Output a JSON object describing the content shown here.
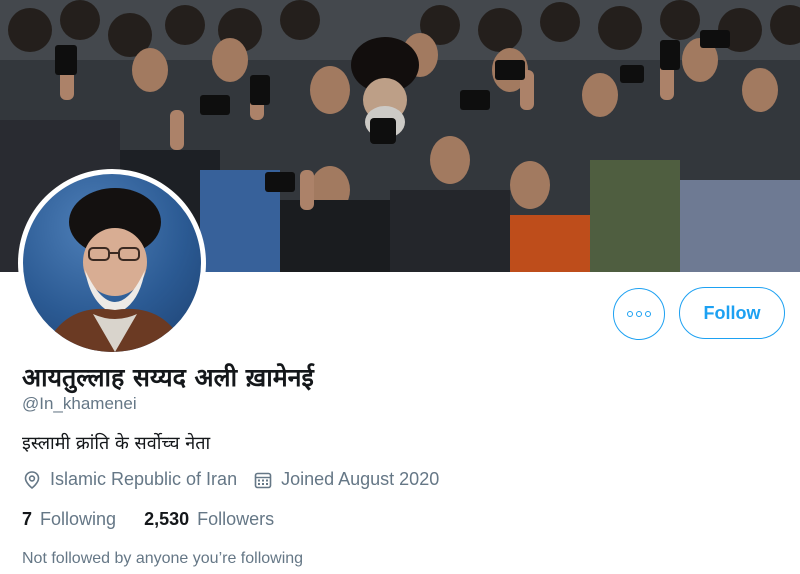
{
  "profile": {
    "display_name": "आयतुल्लाह सय्यद अली ख़ामेनई",
    "handle": "@In_khamenei",
    "bio": "इस्लामी क्रांति के सर्वोच्च नेता",
    "location": "Islamic Republic of Iran",
    "joined": "Joined August 2020",
    "following_count": "7",
    "following_label": "Following",
    "followers_count": "2,530",
    "followers_label": "Followers",
    "mutual_note": "Not followed by anyone you’re following"
  },
  "actions": {
    "follow_label": "Follow",
    "more_icon": "more-options-icon"
  },
  "colors": {
    "accent": "#1da1f2",
    "secondary_text": "#657786",
    "primary_text": "#14171a"
  }
}
